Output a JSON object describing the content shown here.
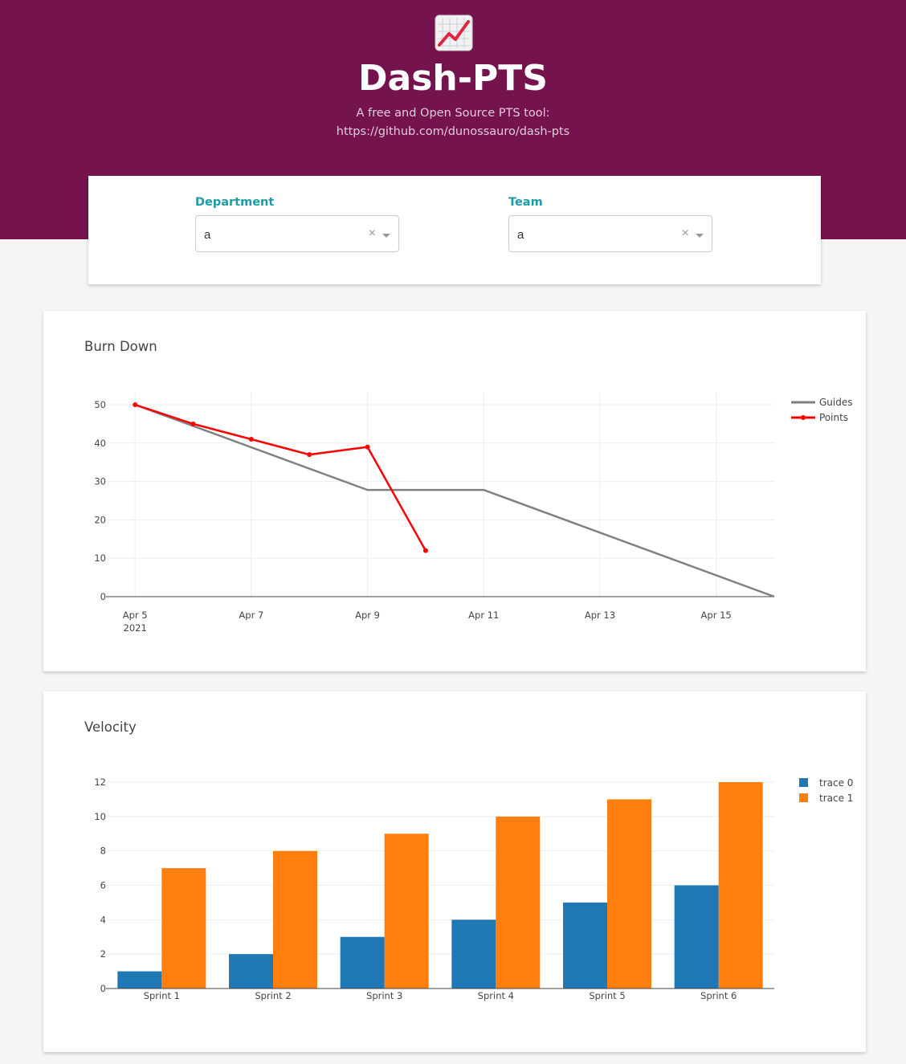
{
  "header": {
    "logo_icon": "chart-increasing-icon",
    "title": "Dash-PTS",
    "subtitle_line1": "A free and Open Source PTS tool:",
    "subtitle_line2": "https://github.com/dunossauro/dash-pts",
    "background_color": "#74134e"
  },
  "filters": {
    "department": {
      "label": "Department",
      "value": "a"
    },
    "team": {
      "label": "Team",
      "value": "a"
    },
    "label_color": "#1e9aa7"
  },
  "chart_data": [
    {
      "type": "line",
      "title": "Burn Down",
      "xlabel": "",
      "ylabel": "",
      "ylim": [
        0,
        50
      ],
      "y_ticks": [
        "0",
        "10",
        "20",
        "30",
        "40",
        "50"
      ],
      "x_ticks": [
        "Apr 5",
        "Apr 7",
        "Apr 9",
        "Apr 11",
        "Apr 13",
        "Apr 15"
      ],
      "x_tick_sublabel": "2021",
      "grid": true,
      "legend_position": "top-right",
      "series": [
        {
          "name": "Guides",
          "color": "#808080",
          "mode": "lines",
          "x": [
            "2021-04-05",
            "2021-04-09",
            "2021-04-11",
            "2021-04-16"
          ],
          "y": [
            50,
            27.8,
            27.8,
            0
          ]
        },
        {
          "name": "Points",
          "color": "#ff0000",
          "mode": "lines+markers",
          "x": [
            "2021-04-05",
            "2021-04-06",
            "2021-04-07",
            "2021-04-08",
            "2021-04-09",
            "2021-04-10"
          ],
          "y": [
            50,
            45,
            41,
            37,
            39,
            12
          ]
        }
      ]
    },
    {
      "type": "bar",
      "title": "Velocity",
      "xlabel": "",
      "ylabel": "",
      "ylim": [
        0,
        12
      ],
      "y_ticks": [
        "0",
        "2",
        "4",
        "6",
        "8",
        "10",
        "12"
      ],
      "categories": [
        "Sprint 1",
        "Sprint 2",
        "Sprint 3",
        "Sprint 4",
        "Sprint 5",
        "Sprint 6"
      ],
      "grid": true,
      "legend_position": "top-right",
      "series": [
        {
          "name": "trace 0",
          "color": "#1f77b4",
          "values": [
            1,
            2,
            3,
            4,
            5,
            6
          ]
        },
        {
          "name": "trace 1",
          "color": "#ff7f0e",
          "values": [
            7,
            8,
            9,
            10,
            11,
            12
          ]
        }
      ]
    }
  ]
}
